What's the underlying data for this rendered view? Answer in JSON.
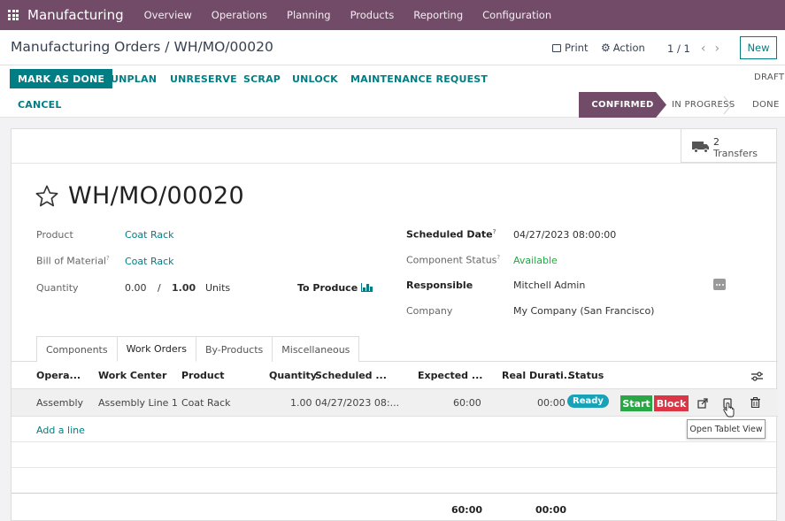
{
  "topbar": {
    "app_name": "Manufacturing",
    "nav": [
      "Overview",
      "Operations",
      "Planning",
      "Products",
      "Reporting",
      "Configuration"
    ]
  },
  "control_panel": {
    "breadcrumb_parent": "Manufacturing Orders",
    "breadcrumb_separator": "/",
    "breadcrumb_current": "WH/MO/00020",
    "print_label": "Print",
    "action_label": "Action",
    "pager": "1 / 1",
    "new_label": "New"
  },
  "status_bar": {
    "buttons": {
      "mark_as_done": "MARK AS DONE",
      "unplan": "UNPLAN",
      "unreserve": "UNRESERVE",
      "scrap": "SCRAP",
      "unlock": "UNLOCK",
      "maintenance_request": "MAINTENANCE REQUEST",
      "cancel": "CANCEL"
    },
    "stages": {
      "draft": "DRAFT",
      "confirmed": "CONFIRMED",
      "in_progress": "IN PROGRESS",
      "done": "DONE"
    },
    "active_stage": "CONFIRMED"
  },
  "button_box": {
    "transfers_count": "2",
    "transfers_label": "Transfers"
  },
  "form": {
    "title": "WH/MO/00020",
    "left": {
      "product_label": "Product",
      "product_value": "Coat Rack",
      "bom_label": "Bill of Material",
      "bom_value": "Coat Rack",
      "quantity_label": "Quantity",
      "quantity_produced": "0.00",
      "quantity_separator": "/",
      "quantity_total": "1.00",
      "quantity_uom": "Units",
      "to_produce_label": "To Produce"
    },
    "right": {
      "scheduled_date_label": "Scheduled Date",
      "scheduled_date_value": "04/27/2023 08:00:00",
      "component_status_label": "Component Status",
      "component_status_value": "Available",
      "responsible_label": "Responsible",
      "responsible_value": "Mitchell Admin",
      "company_label": "Company",
      "company_value": "My Company (San Francisco)"
    },
    "help_mark": "?"
  },
  "tabs": [
    "Components",
    "Work Orders",
    "By-Products",
    "Miscellaneous"
  ],
  "active_tab": "Work Orders",
  "work_orders": {
    "columns": [
      "Opera...",
      "Work Center",
      "Product",
      "Quantity",
      "Scheduled ...",
      "Expected ...",
      "Real Durati...",
      "Status"
    ],
    "rows": [
      {
        "operation": "Assembly",
        "work_center": "Assembly Line 1",
        "product": "Coat Rack",
        "quantity": "1.00",
        "scheduled": "04/27/2023 08:...",
        "expected": "60:00",
        "real_duration": "00:00",
        "status": "Ready",
        "start_label": "Start",
        "block_label": "Block"
      }
    ],
    "add_line": "Add a line",
    "tooltip": "Open Tablet View",
    "totals": {
      "expected": "60:00",
      "real_duration": "00:00"
    }
  },
  "colors": {
    "brand": "#714b67",
    "accent": "#017e84",
    "start": "#28a745",
    "block": "#dc3545",
    "ready": "#17a2b8"
  }
}
